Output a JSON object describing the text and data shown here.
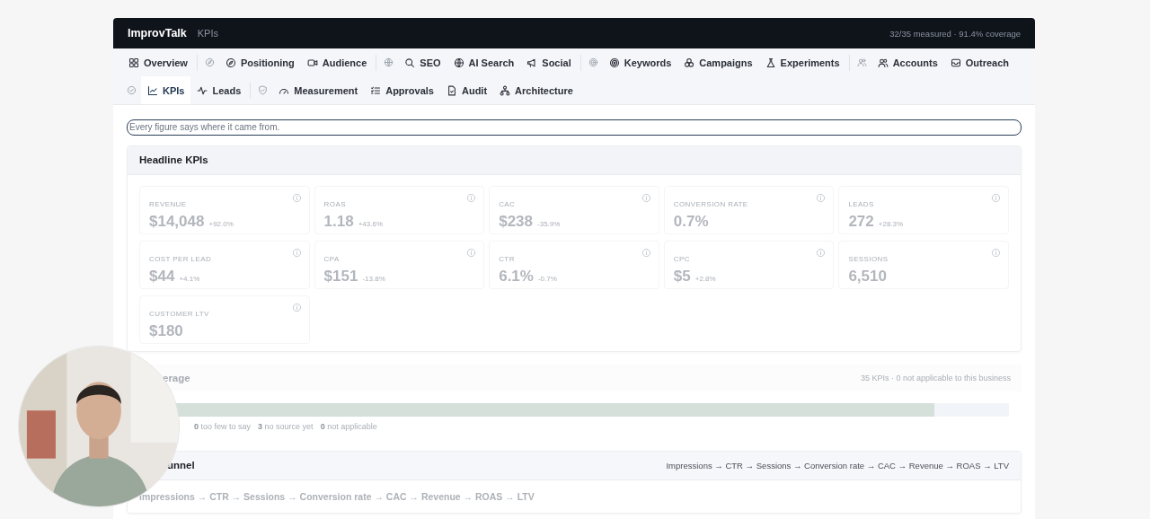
{
  "header": {
    "brand": "ImprovTalk",
    "page": "KPIs",
    "status": "32/35 measured · 91.4% coverage"
  },
  "nav_rows": [
    [
      {
        "kind": "tab",
        "label": "Overview",
        "selected": false
      },
      {
        "kind": "group"
      },
      {
        "kind": "tab",
        "label": "Positioning",
        "selected": false
      },
      {
        "kind": "tab",
        "label": "Audience",
        "selected": false
      },
      {
        "kind": "group"
      },
      {
        "kind": "tab",
        "label": "SEO",
        "selected": false
      },
      {
        "kind": "tab",
        "label": "AI Search",
        "selected": false
      },
      {
        "kind": "tab",
        "label": "Social",
        "selected": false
      },
      {
        "kind": "group"
      },
      {
        "kind": "tab",
        "label": "Keywords",
        "selected": false
      },
      {
        "kind": "tab",
        "label": "Campaigns",
        "selected": false
      },
      {
        "kind": "tab",
        "label": "Experiments",
        "selected": false
      },
      {
        "kind": "group"
      },
      {
        "kind": "tab",
        "label": "Accounts",
        "selected": false
      },
      {
        "kind": "tab",
        "label": "Outreach",
        "selected": false
      }
    ],
    [
      {
        "kind": "group"
      },
      {
        "kind": "tab",
        "label": "KPIs",
        "selected": true
      },
      {
        "kind": "tab",
        "label": "Leads",
        "selected": false
      },
      {
        "kind": "group"
      },
      {
        "kind": "tab",
        "label": "Measurement",
        "selected": false
      },
      {
        "kind": "tab",
        "label": "Approvals",
        "selected": false
      },
      {
        "kind": "tab",
        "label": "Audit",
        "selected": false
      },
      {
        "kind": "tab",
        "label": "Architecture",
        "selected": false
      }
    ]
  ],
  "search": {
    "placeholder": "Every figure says where it came from."
  },
  "headline": {
    "title": "Headline KPIs",
    "tiles": [
      {
        "label": "REVENUE",
        "value": "$14,048",
        "change": "+92.0%"
      },
      {
        "label": "ROAS",
        "value": "1.18",
        "change": "+43.6%"
      },
      {
        "label": "CAC",
        "value": "$238",
        "change": "-35.9%"
      },
      {
        "label": "CONVERSION RATE",
        "value": "0.7%"
      },
      {
        "label": "LEADS",
        "value": "272",
        "change": "+28.3%"
      },
      {
        "label": "COST PER LEAD",
        "value": "$44",
        "change": "+4.1%"
      },
      {
        "label": "CPA",
        "value": "$151",
        "change": "-13.8%"
      },
      {
        "label": "CTR",
        "value": "6.1%",
        "change": "-0.7%"
      },
      {
        "label": "CPC",
        "value": "$5",
        "change": "+2.8%"
      },
      {
        "label": "SESSIONS",
        "value": "6,510"
      },
      {
        "label": "CUSTOMER LTV",
        "value": "$180"
      }
    ]
  },
  "coverage": {
    "title": "erage",
    "note": "35 KPIs · 0 not applicable to this business",
    "level": 0.914,
    "legend": [
      {
        "count": "0",
        "label": "too few to say"
      },
      {
        "count": "3",
        "label": "no source yet"
      },
      {
        "count": "0",
        "label": "not applicable"
      }
    ]
  },
  "funnel": {
    "title": "unnel",
    "summary": "Impressions → CTR → Sessions → Conversion rate → CAC → Revenue → ROAS → LTV",
    "steps": "Impressions → CTR → Sessions → Conversion rate → CAC → Revenue → ROAS → LTV"
  }
}
